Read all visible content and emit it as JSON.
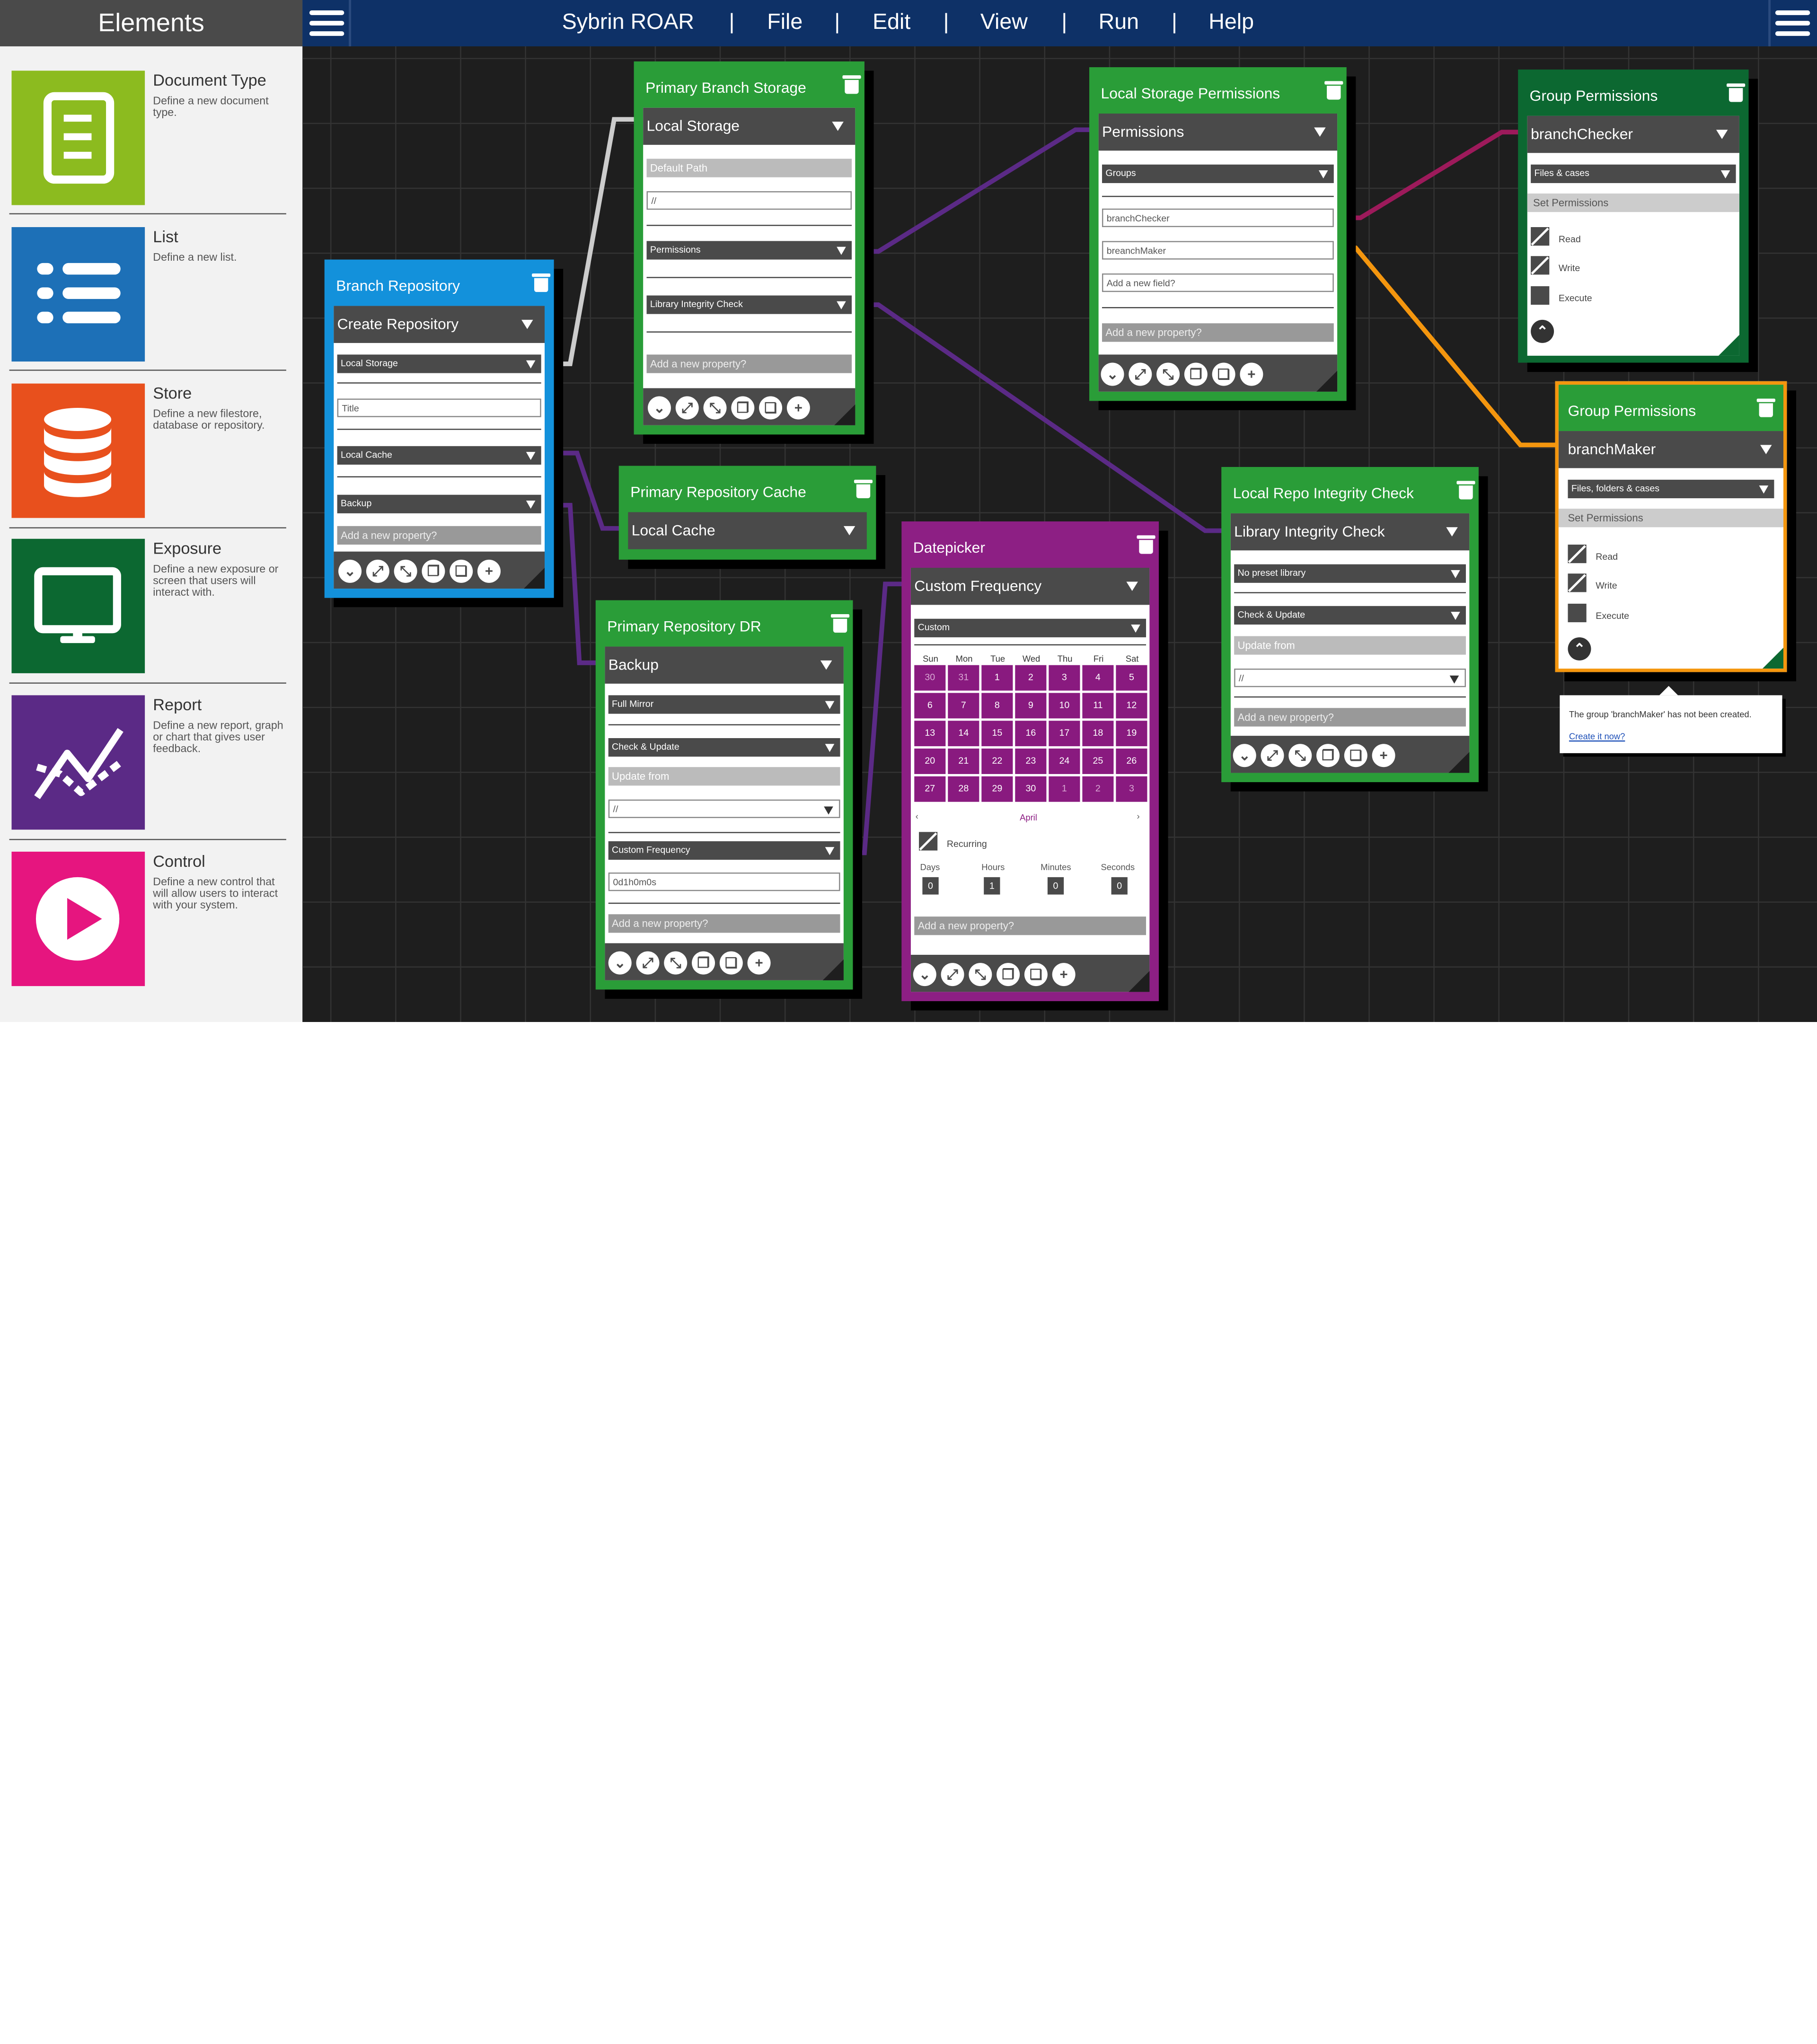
{
  "sidebar": {
    "title": "Elements",
    "items": [
      {
        "title": "Document Type",
        "desc": "Define a new document type.",
        "color": "#8cbb1f",
        "icon": "document-icon"
      },
      {
        "title": "List",
        "desc": "Define a new list.",
        "color": "#1d70b7",
        "icon": "list-icon"
      },
      {
        "title": "Store",
        "desc": "Define a new filestore, database or repository.",
        "color": "#e8501d",
        "icon": "database-icon"
      },
      {
        "title": "Exposure",
        "desc": "Define a new exposure or screen that users will interact with.",
        "color": "#0c6831",
        "icon": "monitor-icon"
      },
      {
        "title": "Report",
        "desc": "Define a new report, graph or chart that gives user feedback.",
        "color": "#5b2a86",
        "icon": "chart-line-icon"
      },
      {
        "title": "Control",
        "desc": "Define a new control that will allow users to interact with your system.",
        "color": "#e6157f",
        "icon": "play-icon"
      }
    ]
  },
  "menu": {
    "app": "Sybrin ROAR",
    "file": "File",
    "edit": "Edit",
    "view": "View",
    "run": "Run",
    "help": "Help",
    "sep": "|"
  },
  "branch": {
    "title": "Branch Repository",
    "header": "Create Repository",
    "local_storage": "Local Storage",
    "title_ph": "Title",
    "local_cache": "Local Cache",
    "backup": "Backup",
    "add": "Add a new property?"
  },
  "pbs": {
    "title": "Primary Branch Storage",
    "header": "Local Storage",
    "default_path": "Default Path",
    "path": "//",
    "permissions": "Permissions",
    "lic": "Library Integrity Check",
    "add": "Add a new property?"
  },
  "prc": {
    "title": "Primary Repository Cache",
    "header": "Local Cache"
  },
  "prdr": {
    "title": "Primary Repository DR",
    "header": "Backup",
    "full_mirror": "Full Mirror",
    "check": "Check & Update",
    "update_from": "Update from",
    "path": "//",
    "custom_freq": "Custom Frequency",
    "freq_val": "0d1h0m0s",
    "add": "Add a new property?"
  },
  "dp": {
    "title": "Datepicker",
    "header": "Custom Frequency",
    "custom": "Custom",
    "days": [
      "Sun",
      "Mon",
      "Tue",
      "Wed",
      "Thu",
      "Fri",
      "Sat"
    ],
    "dates": [
      "30",
      "31",
      "1",
      "2",
      "3",
      "4",
      "5",
      "6",
      "7",
      "8",
      "9",
      "10",
      "11",
      "12",
      "13",
      "14",
      "15",
      "16",
      "17",
      "18",
      "19",
      "20",
      "21",
      "22",
      "23",
      "24",
      "25",
      "26",
      "27",
      "28",
      "29",
      "30",
      "1",
      "2",
      "3"
    ],
    "prev": "‹",
    "next": "›",
    "month": "April",
    "recurring": "Recurring",
    "d_l": "Days",
    "h_l": "Hours",
    "m_l": "Minutes",
    "s_l": "Seconds",
    "d": "0",
    "h": "1",
    "m": "0",
    "s": "0",
    "add": "Add a new property?"
  },
  "lsp": {
    "title": "Local Storage Permissions",
    "header": "Permissions",
    "groups": "Groups",
    "g1": "branchChecker",
    "g2": "breanchMaker",
    "add_field": "Add a new field?",
    "add": "Add a new property?"
  },
  "lric": {
    "title": "Local Repo Integrity Check",
    "header": "Library Integrity Check",
    "preset": "No preset library",
    "check": "Check & Update",
    "update_from": "Update from",
    "path": "//",
    "add": "Add a new property?"
  },
  "gp1": {
    "title": "Group Permissions",
    "header": "branchChecker",
    "scope": "Files & cases",
    "set": "Set Permissions",
    "read": "Read",
    "write": "Write",
    "execute": "Execute"
  },
  "gp2": {
    "title": "Group Permissions",
    "header": "branchMaker",
    "scope": "Files, folders & cases",
    "set": "Set Permissions",
    "read": "Read",
    "write": "Write",
    "execute": "Execute"
  },
  "tooltip": {
    "msg": "The group 'branchMaker' has not been created.",
    "link": "Create it now?"
  },
  "colors": {
    "blue": "#1391db",
    "green": "#2a9d38",
    "purple": "#8d1f84",
    "orange": "#f4960e",
    "wire_purple": "#5b2a86",
    "wire_grey": "#cccccc",
    "wire_magenta": "#9d1a5b"
  }
}
